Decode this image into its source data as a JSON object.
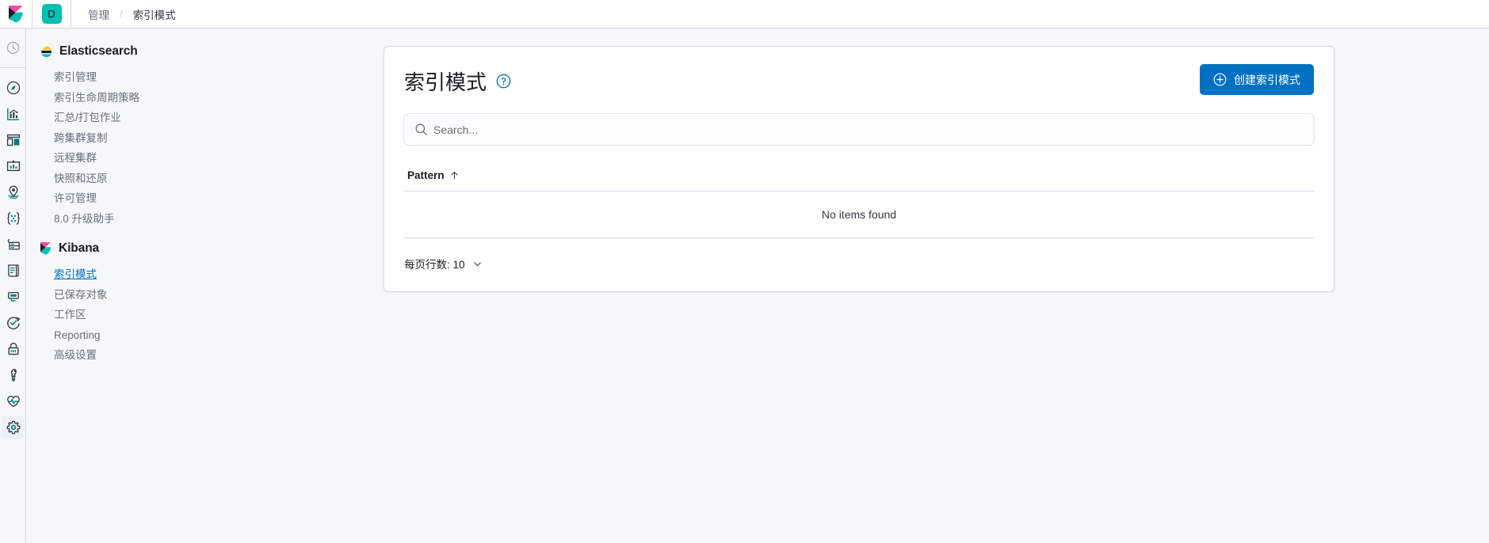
{
  "topbar": {
    "logo_icon": "kibana-logo-icon",
    "space_badge": "D",
    "breadcrumbs": [
      {
        "label": "管理",
        "active": false
      },
      {
        "label": "索引模式",
        "active": true
      }
    ],
    "separator": "/"
  },
  "rail": {
    "items": [
      {
        "name": "recently-viewed-icon",
        "icon": "clock-icon",
        "active": false
      },
      {
        "name": "discover-icon",
        "icon": "compass-icon",
        "active": false
      },
      {
        "name": "visualize-icon",
        "icon": "chart-icon",
        "active": false
      },
      {
        "name": "dashboard-icon",
        "icon": "dashboard-icon",
        "active": false
      },
      {
        "name": "canvas-icon",
        "icon": "presentation-icon",
        "active": false
      },
      {
        "name": "maps-icon",
        "icon": "map-pin-icon",
        "active": false
      },
      {
        "name": "machine-learning-icon",
        "icon": "ml-icon",
        "active": false
      },
      {
        "name": "infrastructure-icon",
        "icon": "infra-icon",
        "active": false
      },
      {
        "name": "logs-icon",
        "icon": "logs-icon",
        "active": false
      },
      {
        "name": "apm-icon",
        "icon": "apm-icon",
        "active": false
      },
      {
        "name": "uptime-icon",
        "icon": "uptime-icon",
        "active": false
      },
      {
        "name": "siem-icon",
        "icon": "lock-icon",
        "active": false
      },
      {
        "name": "dev-tools-icon",
        "icon": "wrench-icon",
        "active": false
      },
      {
        "name": "monitoring-icon",
        "icon": "heart-pulse-icon",
        "active": false
      },
      {
        "name": "management-icon",
        "icon": "gear-icon",
        "active": true
      }
    ]
  },
  "subnav": {
    "sections": [
      {
        "title": "Elasticsearch",
        "logo": "elasticsearch-logo-icon",
        "items": [
          {
            "label": "索引管理",
            "selected": false
          },
          {
            "label": "索引生命周期策略",
            "selected": false
          },
          {
            "label": "汇总/打包作业",
            "selected": false
          },
          {
            "label": "跨集群复制",
            "selected": false
          },
          {
            "label": "远程集群",
            "selected": false
          },
          {
            "label": "快照和还原",
            "selected": false
          },
          {
            "label": "许可管理",
            "selected": false
          },
          {
            "label": "8.0 升级助手",
            "selected": false
          }
        ]
      },
      {
        "title": "Kibana",
        "logo": "kibana-logo-icon",
        "items": [
          {
            "label": "索引模式",
            "selected": true
          },
          {
            "label": "已保存对象",
            "selected": false
          },
          {
            "label": "工作区",
            "selected": false
          },
          {
            "label": "Reporting",
            "selected": false
          },
          {
            "label": "高级设置",
            "selected": false
          }
        ]
      }
    ]
  },
  "main": {
    "page_title": "索引模式",
    "help_icon": "question-circle-icon",
    "create_button": {
      "label": "创建索引模式",
      "icon": "plus-in-circle-icon"
    },
    "search": {
      "placeholder": "Search...",
      "value": "",
      "icon": "search-icon"
    },
    "table": {
      "columns": [
        {
          "label": "Pattern",
          "sort": "asc",
          "sort_icon": "arrow-up-icon"
        }
      ],
      "empty_message": "No items found",
      "rows": []
    },
    "pagination": {
      "rows_per_page_label": "每页行数: 10",
      "rows_per_page_value": "10",
      "chevron_icon": "chevron-down-icon"
    }
  },
  "colors": {
    "accent": "#0071C2",
    "brand_teal": "#00BFB3",
    "brand_pink": "#F04E98",
    "border": "#D3DAE6",
    "page_bg": "#F5F7FA",
    "panel_bg": "#FFFFFF",
    "text_muted": "#69707D",
    "text_dark": "#1A1C21"
  }
}
